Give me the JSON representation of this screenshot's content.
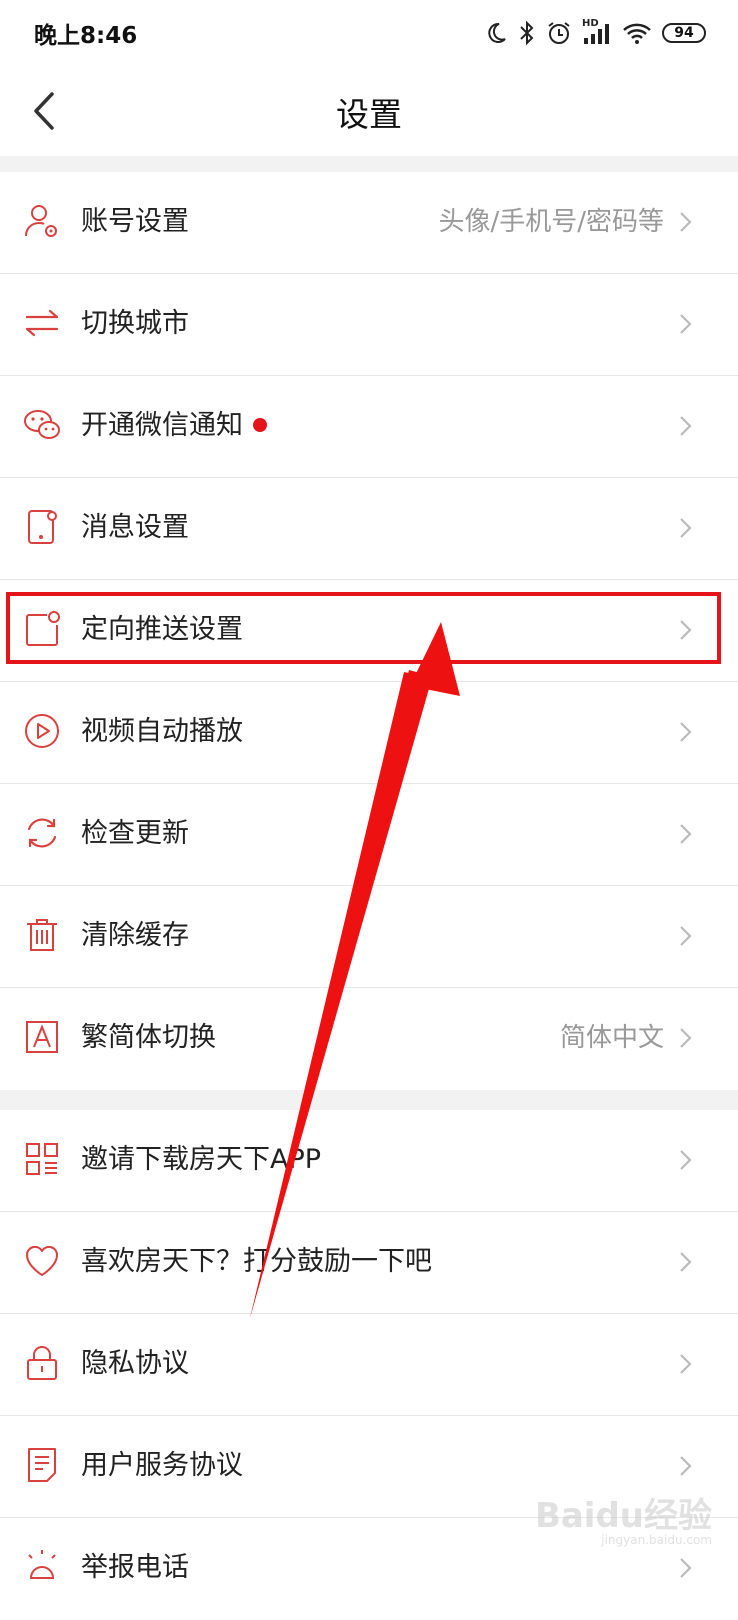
{
  "status_bar": {
    "time": "晚上8:46",
    "network": "HD",
    "battery": "94"
  },
  "header": {
    "title": "设置"
  },
  "group1": [
    {
      "label": "账号设置",
      "value": "头像/手机号/密码等",
      "icon": "account-settings-icon"
    },
    {
      "label": "切换城市",
      "value": "",
      "icon": "switch-arrows-icon"
    },
    {
      "label": "开通微信通知",
      "value": "",
      "icon": "wechat-icon",
      "badge": true
    },
    {
      "label": "消息设置",
      "value": "",
      "icon": "phone-message-icon"
    },
    {
      "label": "定向推送设置",
      "value": "",
      "icon": "push-square-icon"
    },
    {
      "label": "视频自动播放",
      "value": "",
      "icon": "play-circle-icon"
    },
    {
      "label": "检查更新",
      "value": "",
      "icon": "refresh-icon"
    },
    {
      "label": "清除缓存",
      "value": "",
      "icon": "trash-icon"
    },
    {
      "label": "繁简体切换",
      "value": "简体中文",
      "icon": "font-a-icon"
    }
  ],
  "group2": [
    {
      "label": "邀请下载房天下APP",
      "icon": "qrcode-icon"
    },
    {
      "label": "喜欢房天下？打分鼓励一下吧",
      "icon": "heart-icon"
    },
    {
      "label": "隐私协议",
      "icon": "lock-icon"
    },
    {
      "label": "用户服务协议",
      "icon": "document-icon"
    },
    {
      "label": "举报电话",
      "icon": "alarm-icon"
    }
  ],
  "watermark": {
    "brand": "Baidu经验",
    "url": "jingyan.baidu.com"
  },
  "colors": {
    "accent": "#e5141a",
    "icon": "#d9413f",
    "divider": "#e6e6e6",
    "section_gap": "#f2f2f2"
  }
}
